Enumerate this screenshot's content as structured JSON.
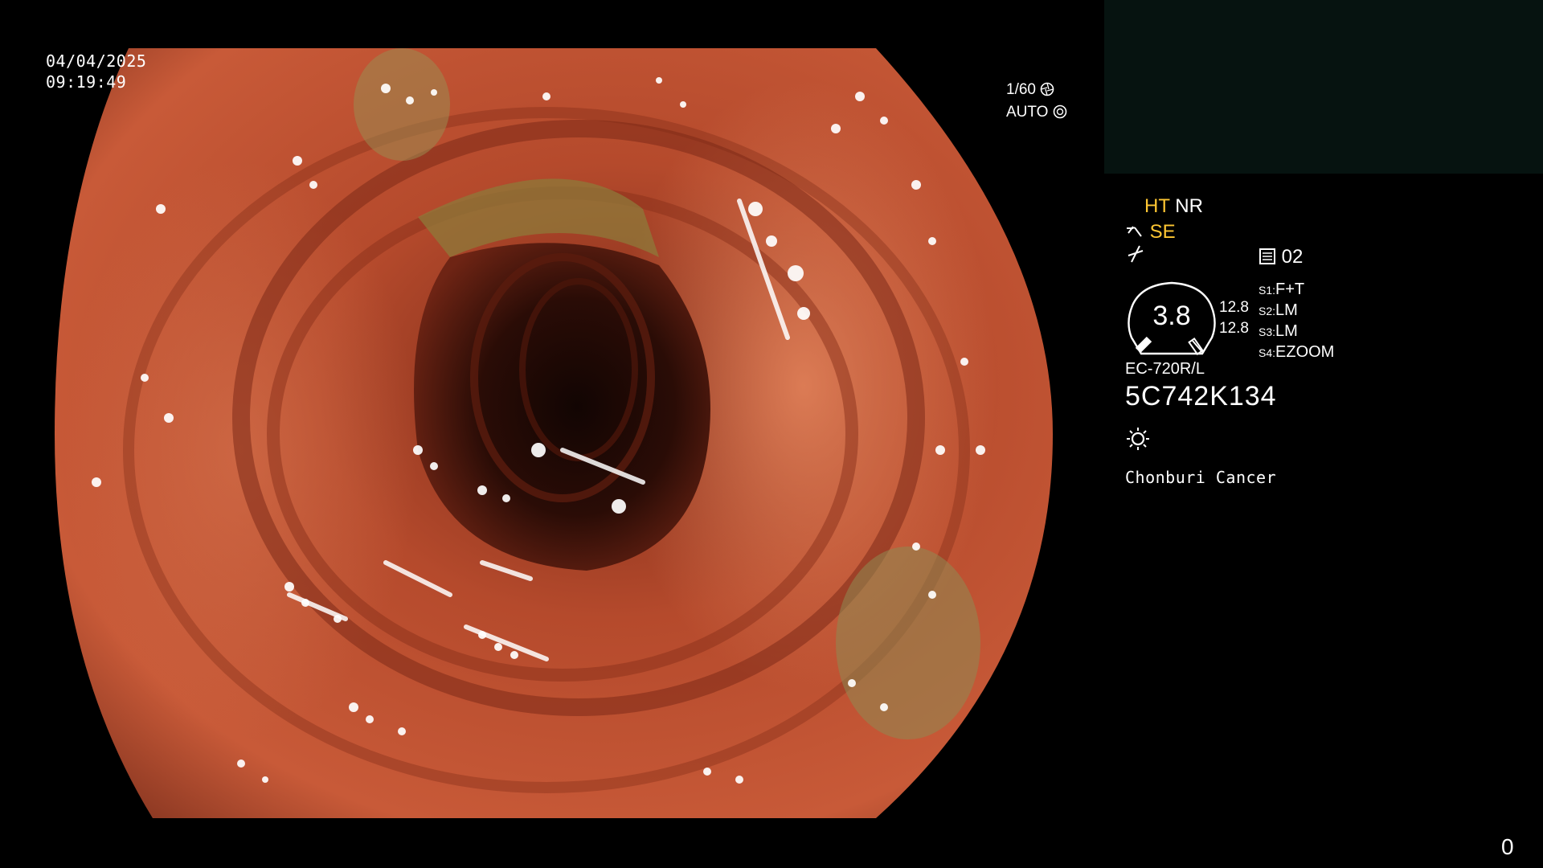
{
  "datetime": {
    "date": "04/04/2025",
    "time": "09:19:49"
  },
  "exposure": {
    "shutter": "1/60",
    "iris": "AUTO"
  },
  "processor": {
    "ht_label": "HT",
    "nr_label": "NR",
    "se_label": "SE",
    "image_mode": "02",
    "zoom_value": "3.8",
    "zoom_ref_top": "12.8",
    "zoom_ref_bottom": "12.8",
    "switches": [
      {
        "key": "S1:",
        "value": "F+T"
      },
      {
        "key": "S2:",
        "value": "LM"
      },
      {
        "key": "S3:",
        "value": "LM"
      },
      {
        "key": "S4:",
        "value": "EZOOM"
      }
    ],
    "scope_model": "EC-720R/L",
    "serial_number": "5C742K134",
    "site_name": "Chonburi Cancer"
  },
  "frame_counter": "0",
  "colors": {
    "highlight": "#ffc733",
    "text": "#ffffff",
    "panel": "#061310"
  },
  "icons": [
    "shutter-icon",
    "iris-icon",
    "structure-icon",
    "color-icon",
    "image-mode-icon",
    "light-icon"
  ]
}
